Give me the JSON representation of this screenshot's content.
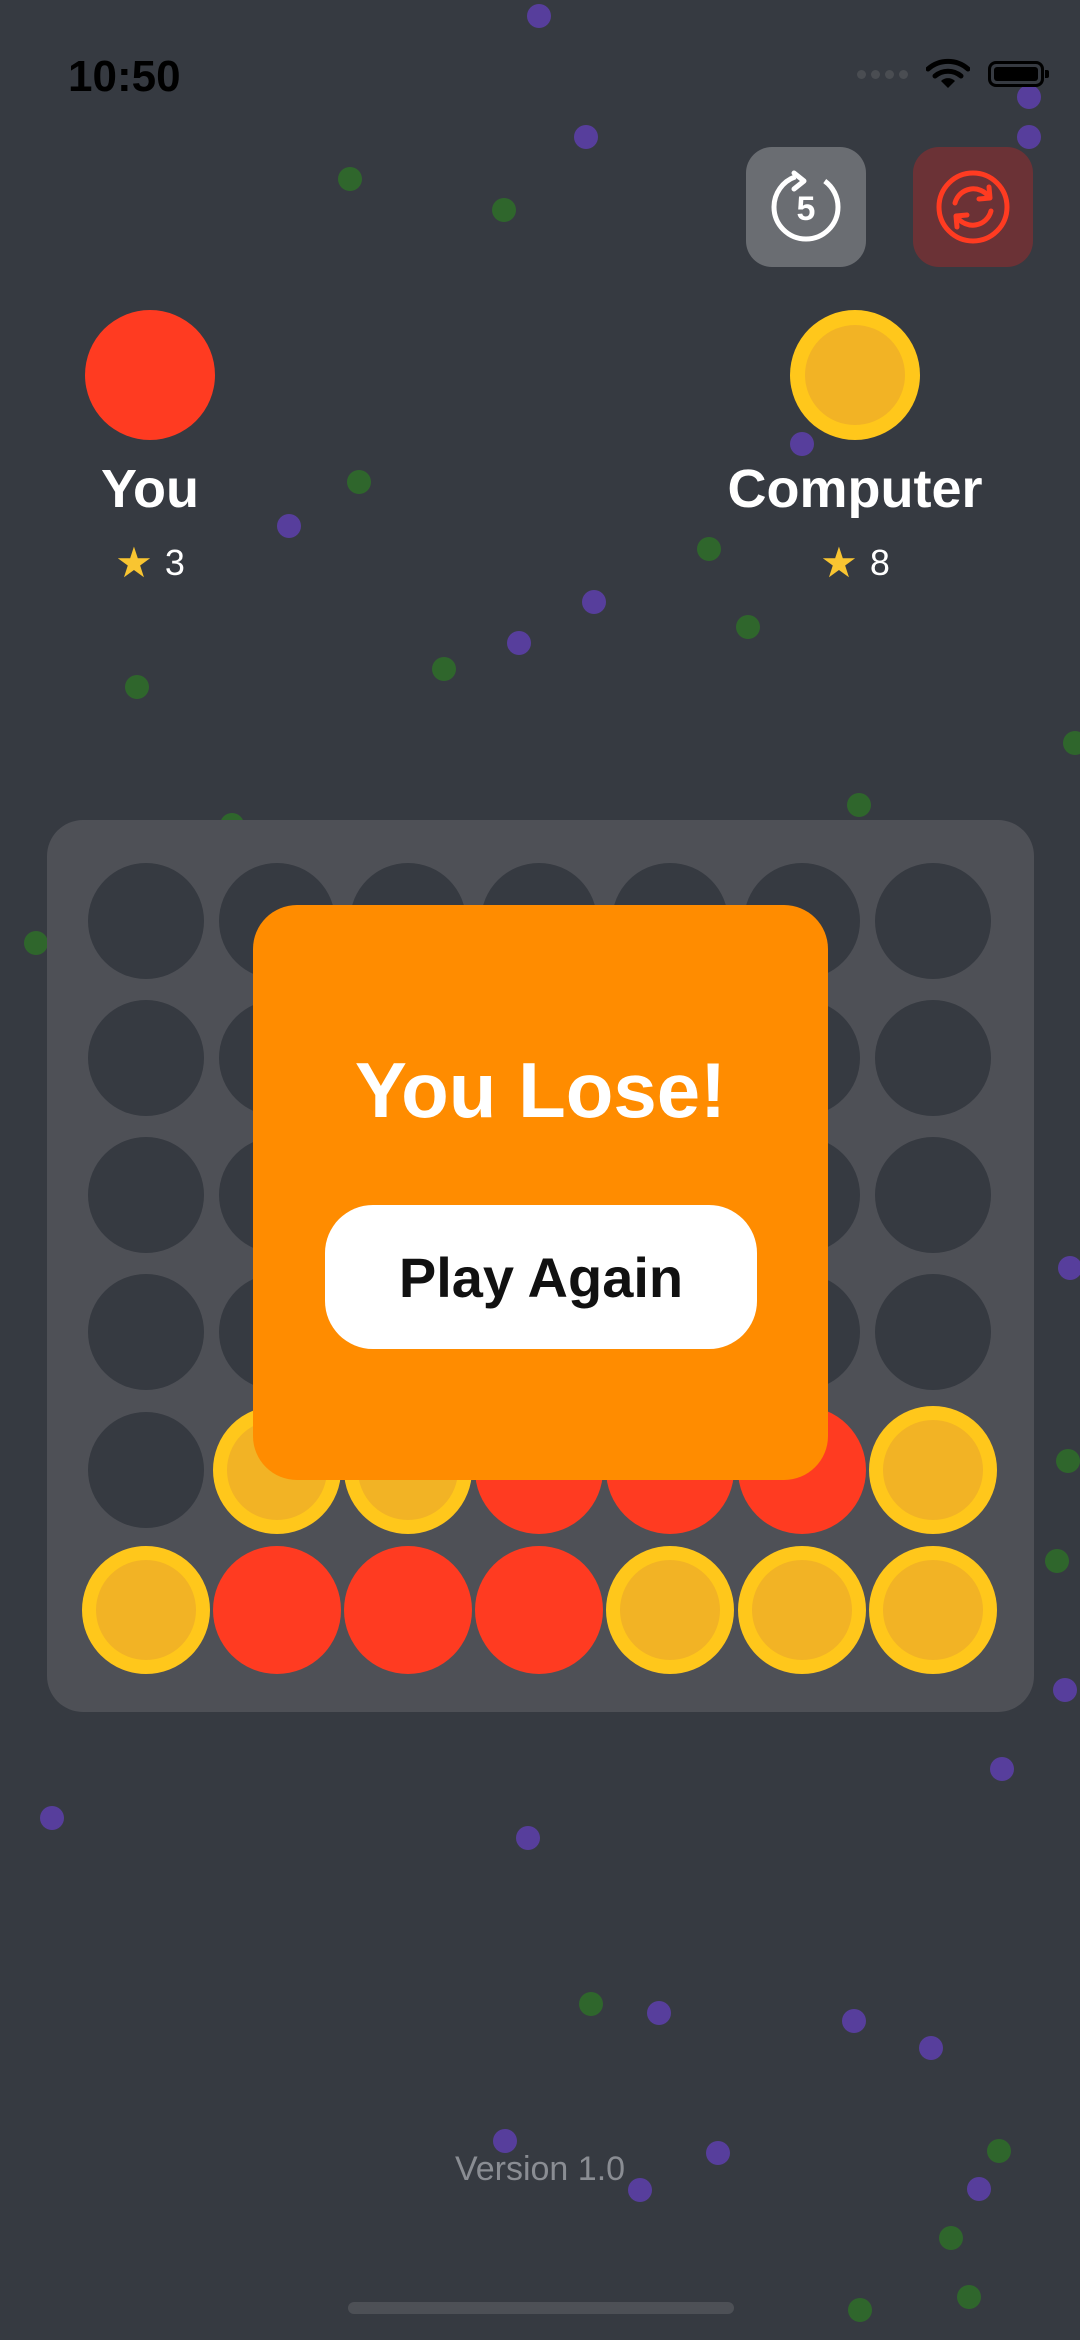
{
  "status_bar": {
    "time": "10:50"
  },
  "controls": {
    "undo_icon": "undo-icon",
    "restart_icon": "restart-icon"
  },
  "players": {
    "you": {
      "name": "You",
      "score": "3",
      "color": "#ff3b21"
    },
    "computer": {
      "name": "Computer",
      "score": "8",
      "color": "#ffc71b"
    }
  },
  "board": {
    "rows": [
      [
        "empty",
        "empty",
        "empty",
        "empty",
        "empty",
        "empty",
        "empty"
      ],
      [
        "empty",
        "empty",
        "empty",
        "empty",
        "empty",
        "empty",
        "empty"
      ],
      [
        "empty",
        "empty",
        "empty",
        "empty",
        "empty",
        "empty",
        "empty"
      ],
      [
        "empty",
        "empty",
        "empty",
        "empty",
        "empty",
        "empty",
        "empty"
      ],
      [
        "empty",
        "yellow",
        "yellow",
        "red",
        "red",
        "red",
        "yellow"
      ],
      [
        "yellow",
        "red",
        "red",
        "red",
        "yellow",
        "yellow",
        "yellow"
      ]
    ]
  },
  "modal": {
    "title": "You Lose!",
    "button_label": "Play Again"
  },
  "footer": {
    "version": "Version 1.0"
  }
}
